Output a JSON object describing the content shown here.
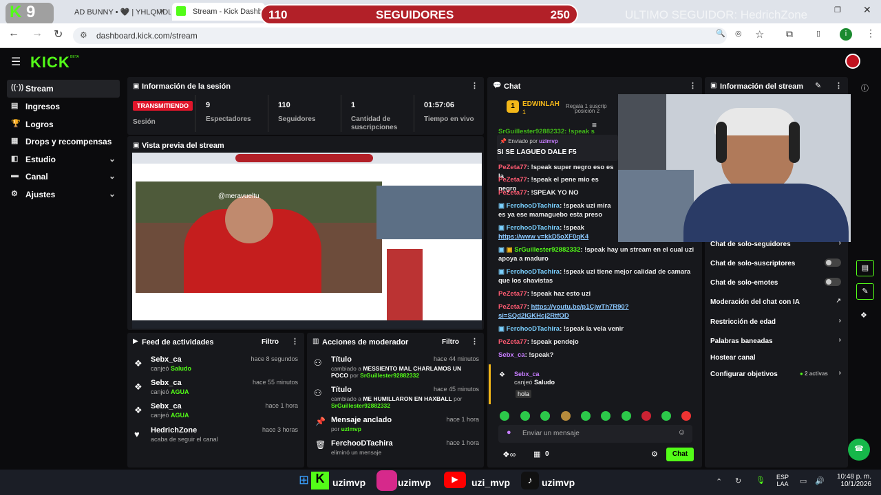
{
  "browser": {
    "tabs": [
      {
        "title": "AD BUNNY • 🖤 | YHLQMDLG"
      },
      {
        "title": "Stream - Kick Dashbo"
      }
    ],
    "url": "dashboard.kick.com/stream",
    "profile_initial": "i"
  },
  "overlay": {
    "left_count": "110",
    "label": "SEGUIDORES",
    "right_count": "250",
    "last_follower": "ULTIMO SEGUIDOR: HedrichZone",
    "badge": "9"
  },
  "app": {
    "logo": "KICK",
    "logo_sup": "BETA"
  },
  "sidebar": {
    "items": [
      {
        "label": "Stream",
        "icon": "stream-icon"
      },
      {
        "label": "Ingresos",
        "icon": "money-icon"
      },
      {
        "label": "Logros",
        "icon": "trophy-icon"
      },
      {
        "label": "Drops y recompensas",
        "icon": "gift-icon"
      },
      {
        "label": "Estudio",
        "icon": "studio-icon"
      },
      {
        "label": "Canal",
        "icon": "channel-icon"
      },
      {
        "label": "Ajustes",
        "icon": "gear-icon"
      }
    ]
  },
  "session": {
    "title": "Información de la sesión",
    "status": "TRANSMITIENDO",
    "status_label": "Sesión",
    "viewers": "9",
    "viewers_label": "Espectadores",
    "followers": "110",
    "followers_label": "Seguidores",
    "subs": "1",
    "subs_label": "Cantidad de suscripciones",
    "time": "01:57:06",
    "time_label": "Tiempo en vivo"
  },
  "preview": {
    "title": "Vista previa del stream",
    "video_handle": "@meravueltu"
  },
  "activity": {
    "title": "Feed de actividades",
    "filter": "Filtro",
    "rows": [
      {
        "name": "Sebx_ca",
        "action": "canjeó",
        "item": "Saludo",
        "time": "hace 8 segundos"
      },
      {
        "name": "Sebx_ca",
        "action": "canjeó",
        "item": "AGUA",
        "time": "hace 55 minutos"
      },
      {
        "name": "Sebx_ca",
        "action": "canjeó",
        "item": "AGUA",
        "time": "hace 1 hora"
      },
      {
        "name": "HedrichZone",
        "action": "acaba de seguir el canal",
        "item": "",
        "time": "hace 3 horas"
      }
    ]
  },
  "mod": {
    "title": "Acciones de moderador",
    "filter": "Filtro",
    "rows": [
      {
        "name": "Título",
        "pre": "cambiado a",
        "value": "MESSIENTO MAL CHARLAMOS UN POCO",
        "by": "por",
        "user": "SrGuillester92882332",
        "time": "hace 44 minutos"
      },
      {
        "name": "Título",
        "pre": "cambiado a",
        "value": "ME HUMILLARON EN HAXBALL",
        "by": "por",
        "user": "SrGuillester92882332",
        "time": "hace 45 minutos"
      },
      {
        "name": "Mensaje anclado",
        "pre": "por",
        "value": "",
        "by": "",
        "user": "uzimvp",
        "time": "hace 1 hora"
      },
      {
        "name": "FerchooDTachira",
        "pre": "eliminó un mensaje",
        "value": "",
        "by": "",
        "user": "",
        "time": "hace 1 hora"
      }
    ]
  },
  "chat": {
    "title": "Chat",
    "top_gifter": {
      "name": "EDWINLAH",
      "rank": "1",
      "count": "1",
      "msg": "Regala 1 suscrip",
      "msg2": "posición 2"
    },
    "pinned_by_label": "Enviado por",
    "pinned_by": "uzimvp",
    "pinned_msg": "SI SE LAGUEO DALE F5",
    "cut_top": "SrGuillester92882332: !speak s",
    "messages": [
      {
        "user": "PeZeta77",
        "text": ": !speak super negro eso es la",
        "cls": "u-red"
      },
      {
        "user": "PeZeta77",
        "text": ": !speak el pene mio es negro",
        "cls": "u-red"
      },
      {
        "user": "PeZeta77",
        "text": ": !SPEAK YO NO",
        "cls": "u-red"
      },
      {
        "user": "FerchooDTachira",
        "text": ": !speak uzi mira es ya ese mamaguebo esta preso",
        "cls": "u-blue"
      },
      {
        "user": "FerchooDTachira",
        "text": ": !speak ",
        "link": "https://www v=kkD5oXF0qK4",
        "cls": "u-blue"
      },
      {
        "user": "SrGuillester92882332",
        "text": ": !speak hay un stream en el cual uzi apoya a maduro",
        "cls": "u-green"
      },
      {
        "user": "FerchooDTachira",
        "text": ": !speak uzi tiene mejor calidad de camara que los chavistas",
        "cls": "u-blue"
      },
      {
        "user": "PeZeta77",
        "text": ": !speak haz esto uzi",
        "cls": "u-red"
      },
      {
        "user": "PeZeta77",
        "text": ": ",
        "link": "https://youtu.be/p1CjwTh7R90?si=SQd2lGKHcj2RtfOD",
        "cls": "u-red"
      },
      {
        "user": "FerchooDTachira",
        "text": ": !speak la vela venir",
        "cls": "u-blue"
      },
      {
        "user": "PeZeta77",
        "text": ": !speak pendejo",
        "cls": "u-red"
      },
      {
        "user": "Sebx_ca",
        "text": ": !speak?",
        "cls": "u-purple"
      }
    ],
    "redeem": {
      "user": "Sebx_ca",
      "action": "canjeó",
      "item": "Saludo",
      "text": "hola"
    },
    "placeholder": "Enviar un mensaje",
    "points": "0",
    "send": "Chat"
  },
  "stream_info": {
    "title": "Información del stream",
    "settings": [
      {
        "label": "Chat de solo-seguidores",
        "kind": "chevron"
      },
      {
        "label": "Chat de solo-suscriptores",
        "kind": "toggle"
      },
      {
        "label": "Chat de solo-emotes",
        "kind": "toggle"
      },
      {
        "label": "Moderación del chat con IA",
        "kind": "external"
      },
      {
        "label": "Restricción de edad",
        "kind": "chevron"
      },
      {
        "label": "Palabras baneadas",
        "kind": "chevron"
      },
      {
        "label": "Hostear canal",
        "kind": "none"
      },
      {
        "label": "Configurar objetivos",
        "kind": "chevron",
        "extra": "2 activas"
      }
    ]
  },
  "taskbar": {
    "overlay_names": [
      "uzimvp",
      "uzimvp",
      "uzi_mvp",
      "uzimvp"
    ],
    "lang": "ESP",
    "lang2": "LAA",
    "time": "10:48 p. m.",
    "date": "10/1/2026"
  },
  "colors": {
    "accent": "#53fc18",
    "live": "#e0162b",
    "panel": "#17181c"
  }
}
